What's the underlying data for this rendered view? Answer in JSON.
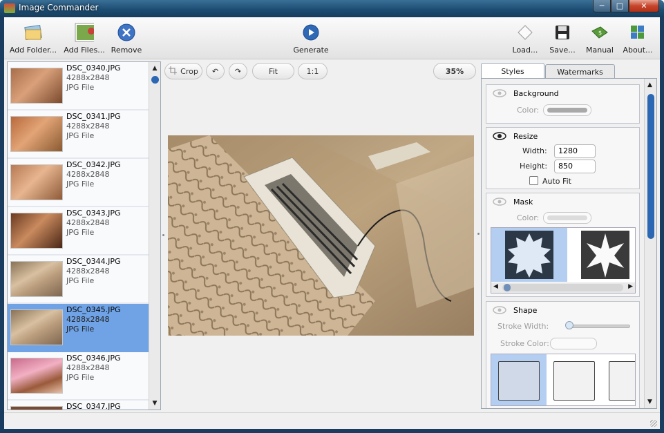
{
  "window": {
    "title": "Image Commander"
  },
  "toolbar": {
    "add_folder": "Add Folder...",
    "add_files": "Add Files...",
    "remove": "Remove",
    "generate": "Generate",
    "load": "Load...",
    "save": "Save...",
    "manual": "Manual",
    "about": "About..."
  },
  "files": [
    {
      "name": "DSC_0340.JPG",
      "dims": "4288x2848",
      "type": "JPG File"
    },
    {
      "name": "DSC_0341.JPG",
      "dims": "4288x2848",
      "type": "JPG File"
    },
    {
      "name": "DSC_0342.JPG",
      "dims": "4288x2848",
      "type": "JPG File"
    },
    {
      "name": "DSC_0343.JPG",
      "dims": "4288x2848",
      "type": "JPG File"
    },
    {
      "name": "DSC_0344.JPG",
      "dims": "4288x2848",
      "type": "JPG File"
    },
    {
      "name": "DSC_0345.JPG",
      "dims": "4288x2848",
      "type": "JPG File",
      "selected": true
    },
    {
      "name": "DSC_0346.JPG",
      "dims": "4288x2848",
      "type": "JPG File"
    },
    {
      "name": "DSC_0347.JPG",
      "dims": "",
      "type": ""
    }
  ],
  "preview": {
    "crop": "Crop",
    "fit": "Fit",
    "one_to_one": "1:1",
    "zoom": "35%"
  },
  "tabs": {
    "styles": "Styles",
    "watermarks": "Watermarks"
  },
  "styles": {
    "background": {
      "title": "Background",
      "color_label": "Color:"
    },
    "resize": {
      "title": "Resize",
      "width_label": "Width:",
      "width": "1280",
      "height_label": "Height:",
      "height": "850",
      "autofit": "Auto Fit"
    },
    "mask": {
      "title": "Mask",
      "color_label": "Color:"
    },
    "shape": {
      "title": "Shape",
      "stroke_width_label": "Stroke Width:",
      "stroke_color_label": "Stroke Color:"
    }
  }
}
